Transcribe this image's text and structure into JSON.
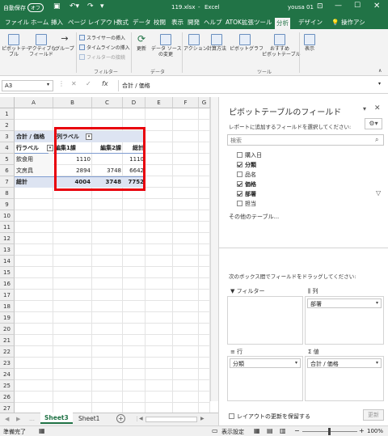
{
  "titlebar": {
    "autosave": "自動保存",
    "autosave_state": "オフ",
    "filename": "119.xlsx",
    "app": "Excel",
    "user": "yousa 01"
  },
  "tabs": [
    "ファイル",
    "ホーム",
    "挿入",
    "ページ レイアウト",
    "数式",
    "データ",
    "校閲",
    "表示",
    "開発",
    "ヘルプ",
    "ATOK拡張ツール",
    "分析",
    "デザイン"
  ],
  "tell_me": "操作アシ",
  "ribbon": {
    "pivot_table": "ピボットテー\nブル",
    "active_field": "アクティブな\nフィールド",
    "group": "グループ",
    "slicer": "スライサーの挿入",
    "timeline": "タイムラインの挿入",
    "filter_conn": "フィルターの接続",
    "filter_group": "フィルター",
    "refresh": "更新",
    "change_source": "データ ソース\nの変更",
    "data_group": "データ",
    "actions": "アクション",
    "calculations": "計算方法",
    "pivot_chart": "ピボットグラフ",
    "recommended": "おすすめ\nピボットテーブル",
    "tools_group": "ツール",
    "show": "表示"
  },
  "formulabar": {
    "namebox": "A3",
    "fx": "fx",
    "formula": "合計 / 価格"
  },
  "grid": {
    "columns": [
      "A",
      "B",
      "C",
      "D",
      "E",
      "F",
      "G"
    ],
    "rows": [
      "1",
      "2",
      "3",
      "4",
      "5",
      "6",
      "7",
      "8",
      "9",
      "10",
      "11",
      "12",
      "13",
      "14",
      "15",
      "16",
      "17",
      "18",
      "19",
      "20",
      "21",
      "22",
      "23",
      "24",
      "25",
      "26",
      "27"
    ],
    "pivot": {
      "corner": "合計 / 価格",
      "col_label": "列ラベル",
      "row_label": "行ラベル",
      "col1": "編集1課",
      "col2": "編集2課",
      "total_hdr": "総計",
      "rows": [
        {
          "label": "飲食用",
          "v1": "1110",
          "v2": "",
          "total": "1110"
        },
        {
          "label": "文房具",
          "v1": "2894",
          "v2": "3748",
          "total": "6642"
        }
      ],
      "grand": {
        "label": "総計",
        "v1": "4004",
        "v2": "3748",
        "total": "7752"
      }
    }
  },
  "sheets": {
    "tabs": [
      "Sheet3",
      "Sheet1"
    ],
    "active": "Sheet3"
  },
  "status": {
    "ready": "準備完了",
    "display_settings": "表示設定",
    "zoom": "100%"
  },
  "pane": {
    "title": "ピボットテーブルのフィールド",
    "subtitle": "レポートに追加するフィールドを選択してください:",
    "search_placeholder": "検索",
    "fields": [
      {
        "name": "購入日",
        "checked": false,
        "bold": false
      },
      {
        "name": "分類",
        "checked": true,
        "bold": true
      },
      {
        "name": "品名",
        "checked": false,
        "bold": false
      },
      {
        "name": "価格",
        "checked": true,
        "bold": true
      },
      {
        "name": "部署",
        "checked": true,
        "bold": true
      },
      {
        "name": "担当",
        "checked": false,
        "bold": false
      }
    ],
    "more_tables": "その他のテーブル...",
    "drag_hint": "次のボックス間でフィールドをドラッグしてください:",
    "areas": {
      "filters": "フィルター",
      "columns": "列",
      "rows": "行",
      "values": "値",
      "columns_chip": "部署",
      "rows_chip": "分類",
      "values_chip": "合計 / 価格"
    },
    "defer": "レイアウトの更新を保留する",
    "update": "更新"
  },
  "colors": {
    "excel_green": "#217346",
    "highlight_red": "#e8000b",
    "pivot_header_bg": "#dde4f2"
  }
}
